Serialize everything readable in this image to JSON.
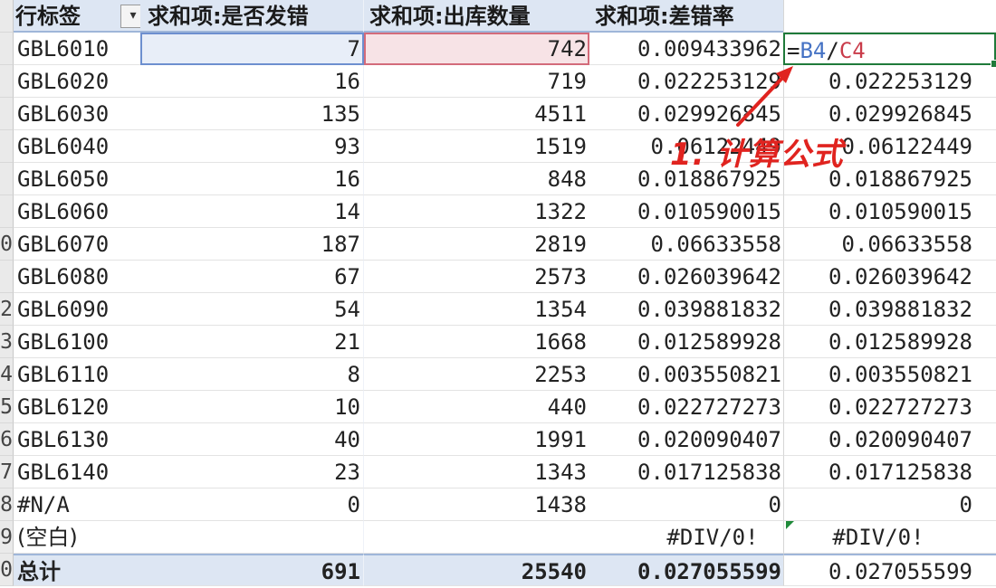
{
  "headers": {
    "col_a": "行标签",
    "col_b": "求和项:是否发错",
    "col_c": "求和项:出库数量",
    "col_d": "求和项:差错率"
  },
  "filter_icon": "dropdown-arrow-icon",
  "active_formula": {
    "eq": "=",
    "ref1": "B4",
    "slash": "/",
    "ref2": "C4"
  },
  "annotation": "1. 计算公式",
  "row_numbers": [
    "",
    "",
    "",
    "",
    "",
    "",
    "",
    "0",
    "",
    "2",
    "3",
    "4",
    "5",
    "6",
    "7",
    "8",
    "9",
    "0"
  ],
  "rows": [
    {
      "label": "GBL6010",
      "errors": "7",
      "qty": "742",
      "rate": "0.009433962",
      "calc": ""
    },
    {
      "label": "GBL6020",
      "errors": "16",
      "qty": "719",
      "rate": "0.022253129",
      "calc": "0.022253129"
    },
    {
      "label": "GBL6030",
      "errors": "135",
      "qty": "4511",
      "rate": "0.029926845",
      "calc": "0.029926845"
    },
    {
      "label": "GBL6040",
      "errors": "93",
      "qty": "1519",
      "rate": "0.06122449",
      "calc": "0.06122449"
    },
    {
      "label": "GBL6050",
      "errors": "16",
      "qty": "848",
      "rate": "0.018867925",
      "calc": "0.018867925"
    },
    {
      "label": "GBL6060",
      "errors": "14",
      "qty": "1322",
      "rate": "0.010590015",
      "calc": "0.010590015"
    },
    {
      "label": "GBL6070",
      "errors": "187",
      "qty": "2819",
      "rate": "0.06633558",
      "calc": "0.06633558"
    },
    {
      "label": "GBL6080",
      "errors": "67",
      "qty": "2573",
      "rate": "0.026039642",
      "calc": "0.026039642"
    },
    {
      "label": "GBL6090",
      "errors": "54",
      "qty": "1354",
      "rate": "0.039881832",
      "calc": "0.039881832"
    },
    {
      "label": "GBL6100",
      "errors": "21",
      "qty": "1668",
      "rate": "0.012589928",
      "calc": "0.012589928"
    },
    {
      "label": "GBL6110",
      "errors": "8",
      "qty": "2253",
      "rate": "0.003550821",
      "calc": "0.003550821"
    },
    {
      "label": "GBL6120",
      "errors": "10",
      "qty": "440",
      "rate": "0.022727273",
      "calc": "0.022727273"
    },
    {
      "label": "GBL6130",
      "errors": "40",
      "qty": "1991",
      "rate": "0.020090407",
      "calc": "0.020090407"
    },
    {
      "label": "GBL6140",
      "errors": "23",
      "qty": "1343",
      "rate": "0.017125838",
      "calc": "0.017125838"
    },
    {
      "label": "#N/A",
      "errors": "0",
      "qty": "1438",
      "rate": "0",
      "calc": "0"
    },
    {
      "label": "(空白)",
      "errors": "",
      "qty": "",
      "rate": "#DIV/0!",
      "calc": "#DIV/0!"
    }
  ],
  "total": {
    "label": "总计",
    "errors": "691",
    "qty": "25540",
    "rate": "0.027055599",
    "calc": "0.027055599"
  },
  "colors": {
    "annotation": "#e0231f",
    "selection_green": "#1f7a3a",
    "pivot_header": "#dde6f3"
  }
}
